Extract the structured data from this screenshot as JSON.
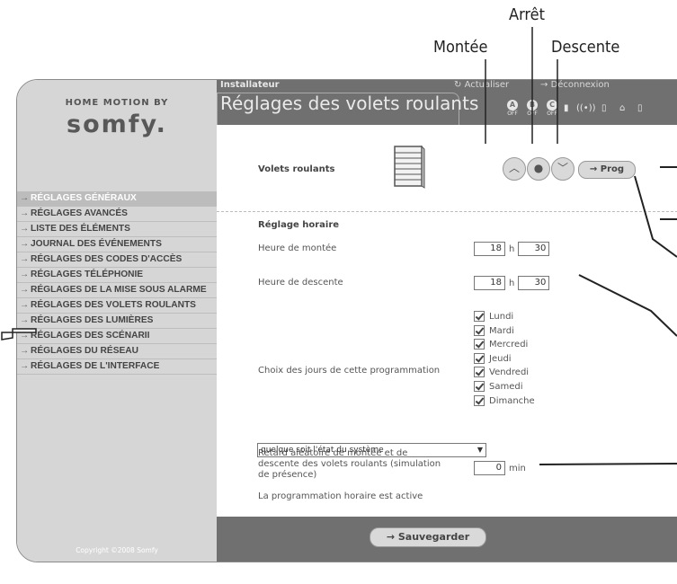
{
  "annotations": {
    "arret": "Arrêt",
    "montee": "Montée",
    "descente": "Descente"
  },
  "brand": {
    "top": "HOME MOTION BY",
    "main": "somfy."
  },
  "sidebar": {
    "items": [
      {
        "label": "RÉGLAGES GÉNÉRAUX",
        "active": true
      },
      {
        "label": "RÉGLAGES AVANCÉS",
        "active": false
      },
      {
        "label": "LISTE DES ÉLÉMENTS",
        "active": false
      },
      {
        "label": "JOURNAL DES ÉVÉNEMENTS",
        "active": false
      },
      {
        "label": "RÉGLAGES DES CODES D'ACCÈS",
        "active": false
      },
      {
        "label": "RÉGLAGES TÉLÉPHONIE",
        "active": false
      },
      {
        "label": "RÉGLAGES DE LA MISE SOUS ALARME",
        "active": false
      },
      {
        "label": "RÉGLAGES DES VOLETS ROULANTS",
        "active": false
      },
      {
        "label": "RÉGLAGES DES LUMIÈRES",
        "active": false
      },
      {
        "label": "RÉGLAGES DES SCÉNARII",
        "active": false
      },
      {
        "label": "RÉGLAGES DU RÉSEAU",
        "active": false
      },
      {
        "label": "RÉGLAGES DE L'INTERFACE",
        "active": false
      }
    ],
    "copyright": "Copyright ©2008 Somfy"
  },
  "header": {
    "role": "Installateur",
    "title": "Réglages des volets roulants",
    "refresh": "Actualiser",
    "logout": "Déconnexion",
    "status": [
      {
        "letter": "A",
        "label": "OFF"
      },
      {
        "letter": "B",
        "label": "OFF"
      },
      {
        "letter": "C",
        "label": "OFF"
      }
    ]
  },
  "shutters": {
    "label": "Volets roulants",
    "prog_label": "Prog"
  },
  "schedule": {
    "heading": "Réglage horaire",
    "up_label": "Heure de montée",
    "up_hour": "18",
    "up_min": "30",
    "down_label": "Heure de descente",
    "down_hour": "18",
    "down_min": "30",
    "unit_h": "h",
    "days_label": "Choix des jours de cette programmation",
    "days": [
      "Lundi",
      "Mardi",
      "Mercredi",
      "Jeudi",
      "Vendredi",
      "Samedi",
      "Dimanche"
    ],
    "random_label_1": "Retard aléatoire de montée et de",
    "random_label_2": "descente des volets roulants (simulation",
    "random_label_3": "de présence)",
    "random_value": "0",
    "random_unit": "min",
    "active_label": "La programmation horaire est active",
    "active_value": "quelque soit l'état du système"
  },
  "footer": {
    "save_label": "Sauvegarder"
  }
}
